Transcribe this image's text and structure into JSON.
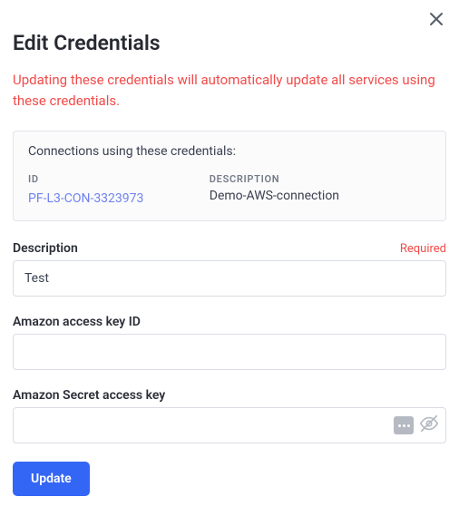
{
  "title": "Edit Credentials",
  "warning": "Updating these credentials will automatically update all services using these credentials.",
  "info_box": {
    "heading": "Connections using these credentials:",
    "id_label": "ID",
    "id_value": "PF-L3-CON-3323973",
    "desc_label": "DESCRIPTION",
    "desc_value": "Demo-AWS-connection"
  },
  "fields": {
    "description": {
      "label": "Description",
      "required_text": "Required",
      "value": "Test"
    },
    "access_key": {
      "label": "Amazon access key ID",
      "value": ""
    },
    "secret_key": {
      "label": "Amazon Secret access key",
      "value": ""
    }
  },
  "buttons": {
    "update": "Update"
  }
}
